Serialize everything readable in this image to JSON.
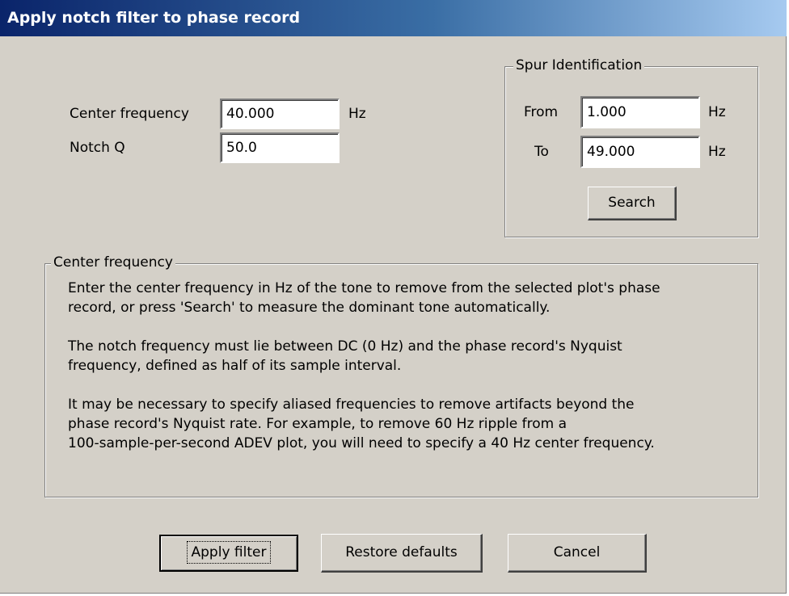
{
  "dialog": {
    "title": "Apply notch filter to phase record"
  },
  "notch": {
    "center_label": "Center frequency",
    "center_value": "40.000",
    "center_unit": "Hz",
    "q_label": "Notch Q",
    "q_value": "50.0"
  },
  "spur": {
    "group_title": "Spur Identification",
    "from_label": "From",
    "from_value": "1.000",
    "from_unit": "Hz",
    "to_label": "To",
    "to_value": "49.000",
    "to_unit": "Hz",
    "search_label": "Search"
  },
  "help": {
    "group_title": "Center frequency",
    "paragraphs": [
      "Enter the center frequency in Hz of the tone to remove from the selected plot's phase\nrecord, or press 'Search' to measure the dominant tone automatically.",
      "The notch frequency must lie between DC (0 Hz) and the phase record's Nyquist\nfrequency, defined as half of its sample interval.",
      "It may be necessary to specify aliased frequencies to remove artifacts beyond the\nphase record's Nyquist rate.  For example, to remove 60 Hz ripple from a\n100-sample-per-second ADEV plot, you will need to specify a 40 Hz center frequency."
    ]
  },
  "buttons": {
    "apply_label": "Apply filter",
    "restore_label": "Restore defaults",
    "cancel_label": "Cancel"
  }
}
